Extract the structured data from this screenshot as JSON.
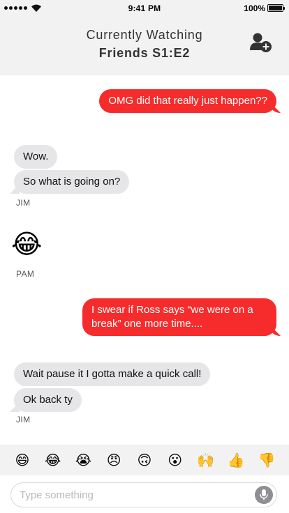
{
  "status_bar": {
    "time": "9:41 PM",
    "battery": "100%",
    "signal_icon": "signal-dots-icon",
    "wifi_icon": "wifi-icon",
    "battery_icon": "battery-icon"
  },
  "header": {
    "subtitle": "Currently Watching",
    "title": "Friends S1:E2",
    "add_user_icon": "add-user-icon"
  },
  "messages": [
    {
      "direction": "out",
      "text": "OMG did that really just happen??"
    },
    {
      "direction": "in",
      "text": "Wow."
    },
    {
      "direction": "in",
      "text": "So what is going on?"
    },
    {
      "sender": "JIM"
    },
    {
      "direction": "in",
      "emoji": "😂"
    },
    {
      "sender": "PAM"
    },
    {
      "direction": "out",
      "text": "I swear if Ross says “we were on a break” one more time...."
    },
    {
      "direction": "in",
      "text": "Wait pause it I gotta make a quick call!"
    },
    {
      "direction": "in",
      "text": "Ok back ty"
    },
    {
      "sender": "JIM"
    }
  ],
  "emoji_bar": [
    "😄",
    "😂",
    "😭",
    "😠",
    "🙃",
    "😮",
    "🙌",
    "👍",
    "👎"
  ],
  "input": {
    "placeholder": "Type something",
    "value": "",
    "mic_icon": "microphone-icon"
  },
  "colors": {
    "accent": "#f62c2c",
    "incoming_bubble": "#e6e6e9",
    "header_bg": "#f2f2f2"
  }
}
